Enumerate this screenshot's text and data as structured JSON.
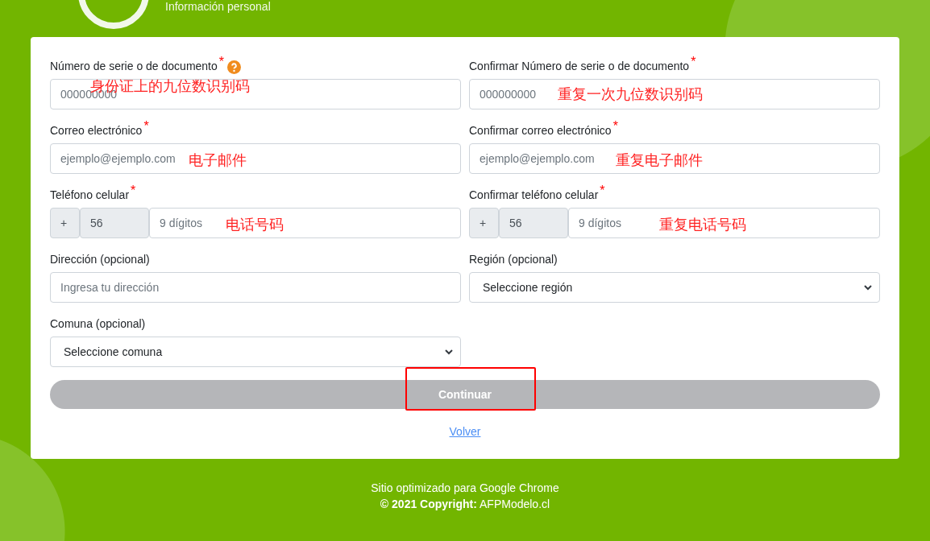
{
  "header": {
    "subtitle": "Información personal"
  },
  "fields": [
    {
      "kind": "text",
      "label": "Número de serie o de documento",
      "marker": "*",
      "help": true,
      "placeholder": "000000000",
      "annotation": "身份证上的九位数识别码"
    },
    {
      "kind": "text",
      "label": "Confirmar Número de serie o de documento",
      "marker": "*",
      "placeholder": "000000000",
      "annotation": "重复一次九位数识别码"
    },
    {
      "kind": "text",
      "label": "Correo electrónico",
      "marker": "*",
      "placeholder": "ejemplo@ejemplo.com",
      "annotation": "电子邮件"
    },
    {
      "kind": "text",
      "label": "Confirmar correo electrónico",
      "marker": "*",
      "placeholder": "ejemplo@ejemplo.com",
      "annotation": "重复电子邮件"
    },
    {
      "kind": "phone",
      "label": "Teléfono celular",
      "marker": "*",
      "prefix": "+",
      "code": "56",
      "placeholder": "9 dígitos",
      "annotation": "电话号码"
    },
    {
      "kind": "phone",
      "label": "Confirmar teléfono celular",
      "marker": "*",
      "prefix": "+",
      "code": "56",
      "placeholder": "9 dígitos",
      "annotation": "重复电话号码"
    },
    {
      "kind": "text",
      "label": "Dirección (opcional)",
      "placeholder": "Ingresa tu dirección"
    },
    {
      "kind": "select",
      "label": "Región (opcional)",
      "value": "Seleccione región"
    },
    {
      "kind": "select",
      "label": "Comuna (opcional)",
      "value": "Seleccione comuna"
    }
  ],
  "continue_button": {
    "label": "Continuar",
    "disabled": true,
    "highlighted": true
  },
  "back_link": "Volver",
  "footer": {
    "line1": "Sitio optimizado para Google Chrome",
    "copyright": "**© 2021 Copyright:** AFPModelo.cl"
  }
}
